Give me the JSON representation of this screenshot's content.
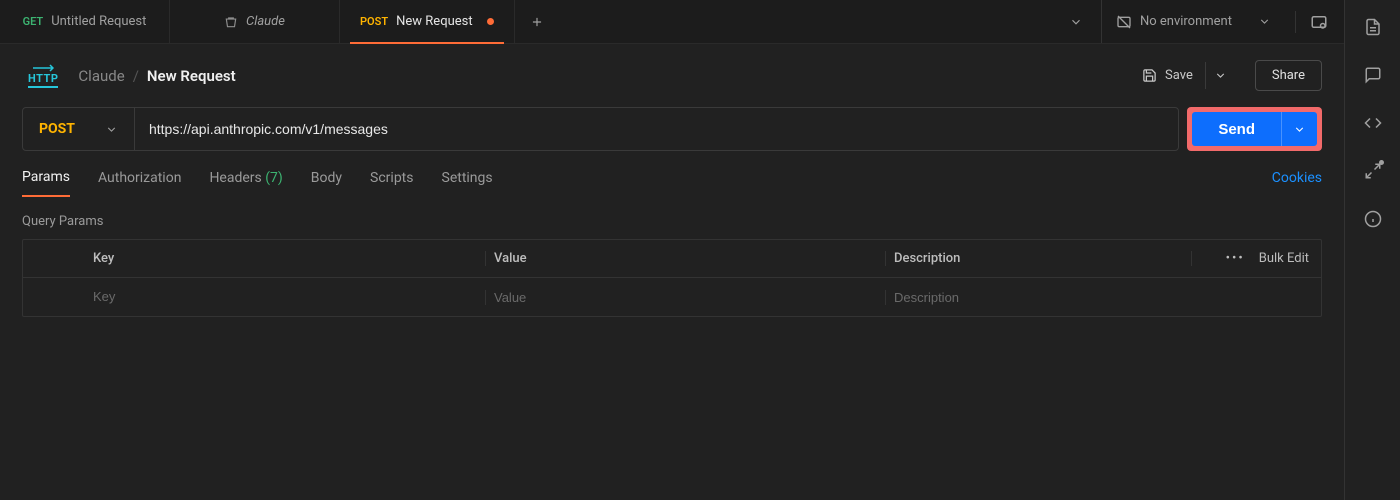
{
  "tabs": [
    {
      "method": "GET",
      "label": "Untitled Request",
      "active": false
    },
    {
      "icon": "collection",
      "label": "Claude",
      "active": false
    },
    {
      "method": "POST",
      "label": "New Request",
      "active": true,
      "dirty": true
    }
  ],
  "tab_dropdown_icon": "chevron-down",
  "environment": {
    "label": "No environment"
  },
  "breadcrumb": {
    "parent": "Claude",
    "sep": "/",
    "current": "New Request"
  },
  "actions": {
    "save": "Save",
    "share": "Share"
  },
  "request": {
    "method": "POST",
    "url": "https://api.anthropic.com/v1/messages",
    "send": "Send"
  },
  "request_tabs": [
    {
      "label": "Params",
      "active": true
    },
    {
      "label": "Authorization"
    },
    {
      "label": "Headers",
      "count": "(7)"
    },
    {
      "label": "Body"
    },
    {
      "label": "Scripts"
    },
    {
      "label": "Settings"
    }
  ],
  "cookies_link": "Cookies",
  "query_params": {
    "title": "Query Params",
    "headers": {
      "key": "Key",
      "value": "Value",
      "description": "Description"
    },
    "bulk_edit": "Bulk Edit",
    "placeholders": {
      "key": "Key",
      "value": "Value",
      "description": "Description"
    }
  }
}
